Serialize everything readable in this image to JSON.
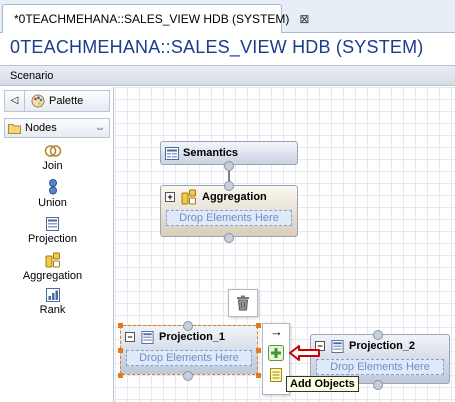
{
  "editor_tab": {
    "label": "*0TEACHMEHANA::SALES_VIEW HDB (SYSTEM)",
    "close": "⊠"
  },
  "page_title": "0TEACHMEHANA::SALES_VIEW HDB (SYSTEM)",
  "scenario_label": "Scenario",
  "palette": {
    "back": "◁",
    "label": "Palette",
    "nodes_label": "Nodes",
    "collapse": "⇔",
    "items": [
      {
        "label": "Join",
        "icon": "join-icon"
      },
      {
        "label": "Union",
        "icon": "union-icon"
      },
      {
        "label": "Projection",
        "icon": "projection-icon"
      },
      {
        "label": "Aggregation",
        "icon": "aggregation-icon"
      },
      {
        "label": "Rank",
        "icon": "rank-icon"
      }
    ]
  },
  "canvas": {
    "semantics": {
      "label": "Semantics"
    },
    "aggregation": {
      "label": "Aggregation",
      "drop": "Drop Elements Here"
    },
    "projection_1": {
      "label": "Projection_1",
      "drop": "Drop Elements Here"
    },
    "projection_2": {
      "label": "Projection_2",
      "drop": "Drop Elements Here"
    },
    "toolbox": {
      "arrow": "→",
      "tooltip": "Add Objects"
    }
  },
  "colors": {
    "title": "#1a3d8c",
    "selection": "#e07a1c",
    "drop_zone": "#dfe9f8",
    "arrow": "#cc0000"
  }
}
